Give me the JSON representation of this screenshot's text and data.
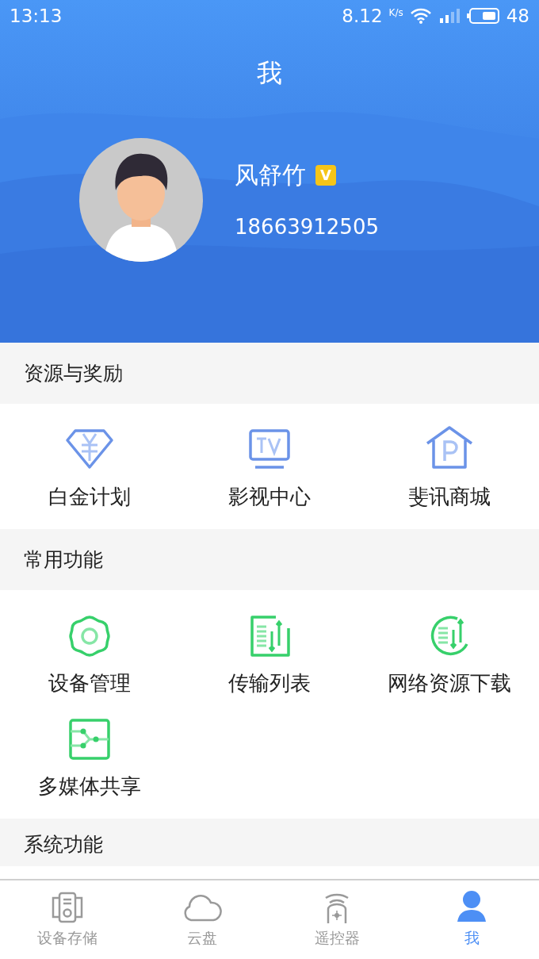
{
  "status_bar": {
    "time": "13:13",
    "net_speed": "8.12",
    "net_unit": "K/s",
    "battery": "48"
  },
  "header": {
    "title": "我"
  },
  "profile": {
    "name": "风舒竹",
    "verified": true,
    "badge": "V",
    "phone": "18663912505"
  },
  "sections": [
    {
      "title": "资源与奖励",
      "items": [
        {
          "label": "白金计划",
          "kind": "diamond"
        },
        {
          "label": "影视中心",
          "kind": "tv"
        },
        {
          "label": "斐讯商城",
          "kind": "shop"
        }
      ]
    },
    {
      "title": "常用功能",
      "items": [
        {
          "label": "设备管理",
          "kind": "gear"
        },
        {
          "label": "传输列表",
          "kind": "transfer"
        },
        {
          "label": "网络资源下载",
          "kind": "download"
        },
        {
          "label": "多媒体共享",
          "kind": "share"
        }
      ]
    },
    {
      "title": "系统功能"
    }
  ],
  "tab_bar": [
    {
      "label": "设备存储",
      "kind": "storage",
      "selected": false
    },
    {
      "label": "云盘",
      "kind": "cloud",
      "selected": false
    },
    {
      "label": "遥控器",
      "kind": "remote",
      "selected": false
    },
    {
      "label": "我",
      "kind": "person",
      "selected": true
    }
  ]
}
